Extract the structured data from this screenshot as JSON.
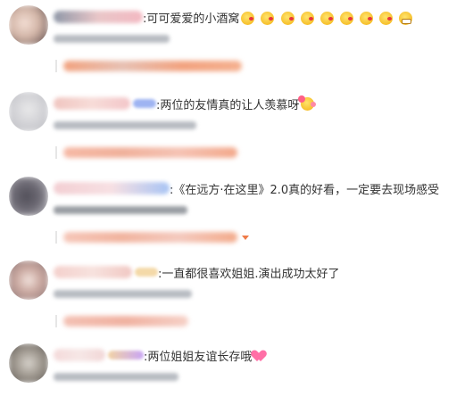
{
  "comments": [
    {
      "text": ":可可爱爱的小酒窝",
      "emojis": [
        "kiss-emoji",
        "kiss-emoji",
        "kiss-emoji",
        "kiss-emoji",
        "kiss-emoji",
        "kiss-emoji",
        "kiss-emoji",
        "kiss-emoji",
        "grin-emoji"
      ]
    },
    {
      "text": ":两位的友情真的让人羡慕呀",
      "emojis": [
        "heart-eyes-emoji"
      ]
    },
    {
      "text": ":《在远方·在这里》2.0真的好看，一定要去现场感受",
      "emojis": []
    },
    {
      "text": ":一直都很喜欢姐姐.演出成功太好了",
      "emojis": []
    },
    {
      "text": ":两位姐姐友谊长存哦",
      "emojis": [
        "heart-emoji"
      ]
    }
  ],
  "colors": {
    "text": "#333333",
    "meta": "#939393",
    "reply_accent": "#ef7b48"
  }
}
